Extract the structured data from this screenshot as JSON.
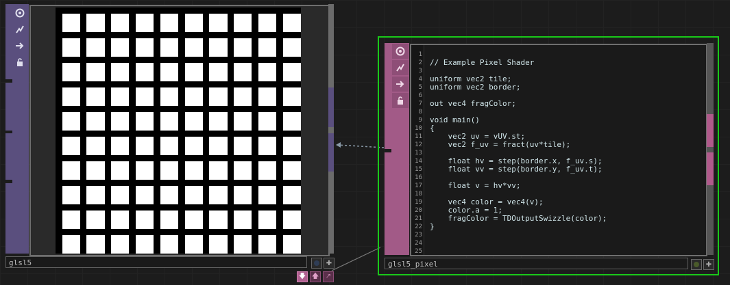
{
  "nodes": {
    "left": {
      "name": "glsl5",
      "accent": "#5a4f7e",
      "icons": [
        "viewer-icon",
        "bypass-icon",
        "cook-icon",
        "lock-icon"
      ],
      "grid": {
        "cols": 10,
        "rows": 10,
        "tile_color": "#ffffff",
        "background": "#000000"
      }
    },
    "right": {
      "name": "glsl5_pixel",
      "accent": "#a25a87",
      "selected_border": "#19c919",
      "icons": [
        "viewer-icon",
        "bypass-icon",
        "cook-icon",
        "lock-icon"
      ],
      "code": [
        "",
        "// Example Pixel Shader",
        "",
        "uniform vec2 tile;",
        "uniform vec2 border;",
        "",
        "out vec4 fragColor;",
        "",
        "void main()",
        "{",
        "    vec2 uv = vUV.st;",
        "    vec2 f_uv = fract(uv*tile);",
        "",
        "    float hv = step(border.x, f_uv.s);",
        "    float vv = step(border.y, f_uv.t);",
        "",
        "    float v = hv*vv;",
        "",
        "    vec4 color = vec4(v);",
        "    color.a = 1;",
        "    fragColor = TDOutputSwizzle(color);",
        "}",
        "",
        "",
        ""
      ],
      "line_numbers": [
        "1",
        "2",
        "3",
        "4",
        "5",
        "6",
        "7",
        "8",
        "9",
        "10",
        "11",
        "12",
        "13",
        "14",
        "15",
        "16",
        "17",
        "18",
        "19",
        "20",
        "21",
        "22",
        "23",
        "24",
        "25"
      ]
    }
  },
  "bottom_buttons": [
    "down-arrow-icon",
    "up-arrow-icon",
    "diagonal-arrow-icon"
  ]
}
